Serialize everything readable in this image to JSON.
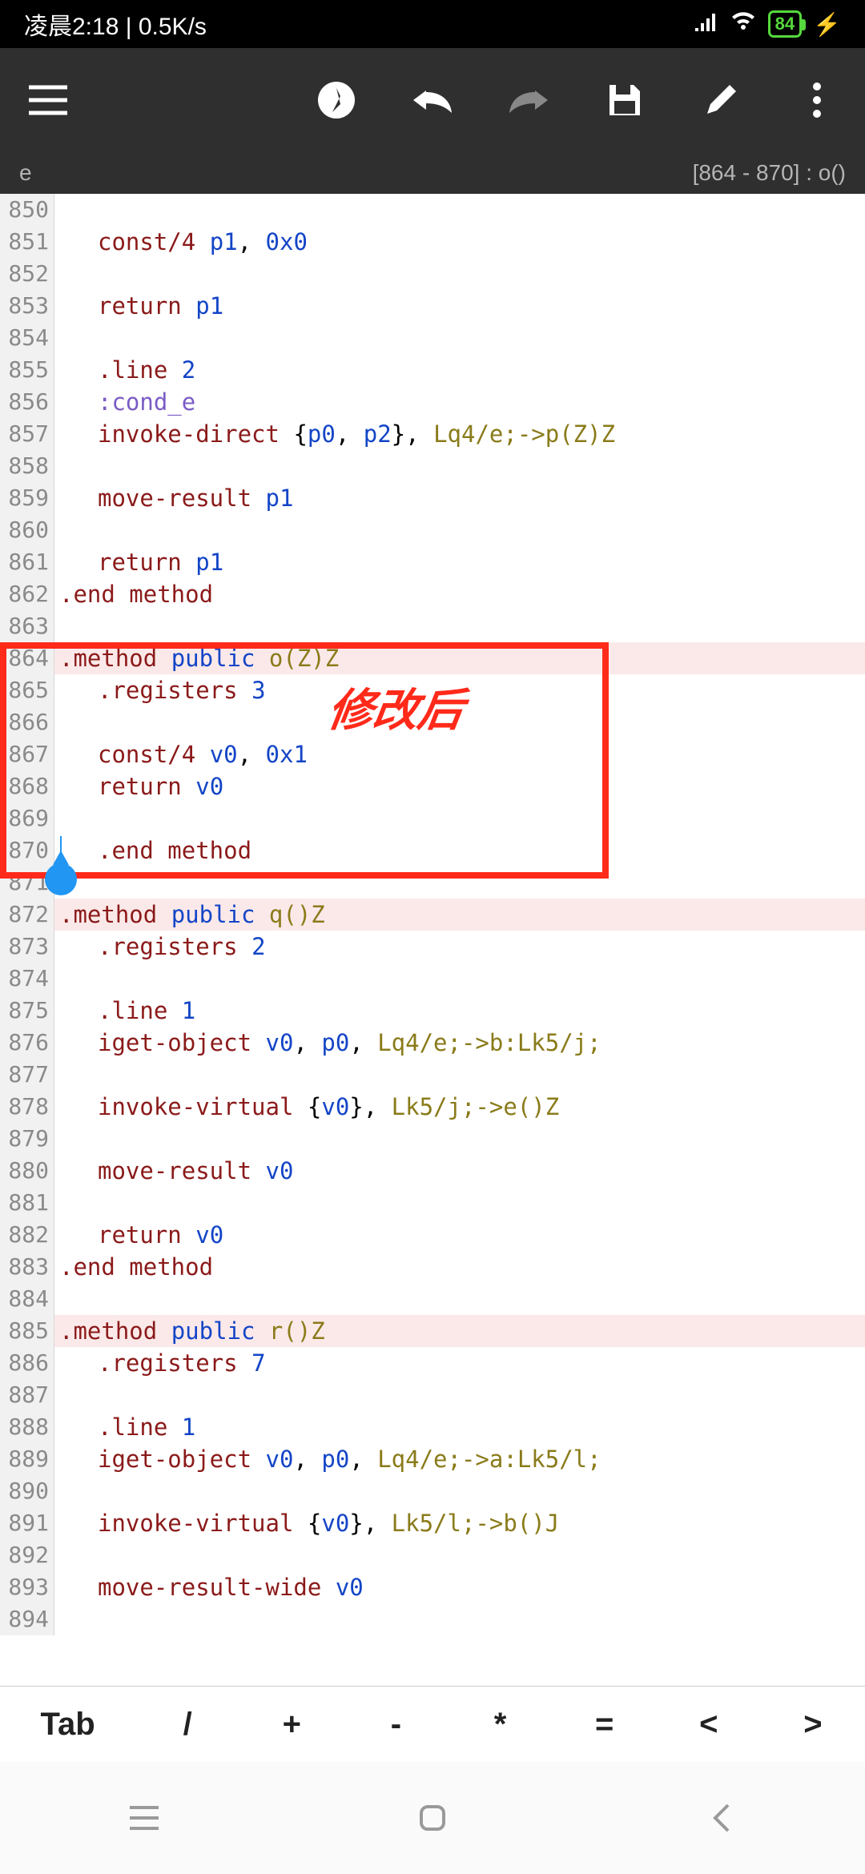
{
  "status": {
    "time_text": "凌晨2:18 | 0.5K/s",
    "battery": "84"
  },
  "meta": {
    "file": "e",
    "location": "[864 - 870] : o()"
  },
  "annotation": "修改后",
  "lines": [
    {
      "n": "850",
      "bg": "",
      "indent": 0,
      "tokens": []
    },
    {
      "n": "851",
      "bg": "",
      "indent": 1,
      "tokens": [
        {
          "c": "c-keyword",
          "t": "const/4"
        },
        {
          "c": "",
          "t": " "
        },
        {
          "c": "c-reg",
          "t": "p1"
        },
        {
          "c": "",
          "t": ", "
        },
        {
          "c": "c-num",
          "t": "0x0"
        }
      ]
    },
    {
      "n": "852",
      "bg": "",
      "indent": 0,
      "tokens": []
    },
    {
      "n": "853",
      "bg": "",
      "indent": 1,
      "tokens": [
        {
          "c": "c-keyword",
          "t": "return"
        },
        {
          "c": "",
          "t": " "
        },
        {
          "c": "c-reg",
          "t": "p1"
        }
      ]
    },
    {
      "n": "854",
      "bg": "",
      "indent": 0,
      "tokens": []
    },
    {
      "n": "855",
      "bg": "",
      "indent": 1,
      "tokens": [
        {
          "c": "c-keyword",
          "t": ".line"
        },
        {
          "c": "",
          "t": " "
        },
        {
          "c": "c-num",
          "t": "2"
        }
      ]
    },
    {
      "n": "856",
      "bg": "",
      "indent": 1,
      "tokens": [
        {
          "c": "c-label",
          "t": ":cond_e"
        }
      ]
    },
    {
      "n": "857",
      "bg": "",
      "indent": 1,
      "tokens": [
        {
          "c": "c-keyword",
          "t": "invoke-direct"
        },
        {
          "c": "",
          "t": " {"
        },
        {
          "c": "c-reg",
          "t": "p0"
        },
        {
          "c": "",
          "t": ", "
        },
        {
          "c": "c-reg",
          "t": "p2"
        },
        {
          "c": "",
          "t": "}, "
        },
        {
          "c": "c-type",
          "t": "Lq4/e;->p(Z)Z"
        }
      ]
    },
    {
      "n": "858",
      "bg": "",
      "indent": 0,
      "tokens": []
    },
    {
      "n": "859",
      "bg": "",
      "indent": 1,
      "tokens": [
        {
          "c": "c-keyword",
          "t": "move-result"
        },
        {
          "c": "",
          "t": " "
        },
        {
          "c": "c-reg",
          "t": "p1"
        }
      ]
    },
    {
      "n": "860",
      "bg": "",
      "indent": 0,
      "tokens": []
    },
    {
      "n": "861",
      "bg": "",
      "indent": 1,
      "tokens": [
        {
          "c": "c-keyword",
          "t": "return"
        },
        {
          "c": "",
          "t": " "
        },
        {
          "c": "c-reg",
          "t": "p1"
        }
      ]
    },
    {
      "n": "862",
      "bg": "",
      "indent": 0,
      "tokens": [
        {
          "c": "c-keyword",
          "t": ".end method"
        }
      ]
    },
    {
      "n": "863",
      "bg": "",
      "indent": 0,
      "tokens": []
    },
    {
      "n": "864",
      "bg": "bg-pink",
      "indent": 0,
      "tokens": [
        {
          "c": "c-keyword",
          "t": ".method"
        },
        {
          "c": "",
          "t": " "
        },
        {
          "c": "c-mod",
          "t": "public"
        },
        {
          "c": "",
          "t": " "
        },
        {
          "c": "c-type",
          "t": "o(Z)Z"
        }
      ]
    },
    {
      "n": "865",
      "bg": "",
      "indent": 1,
      "tokens": [
        {
          "c": "c-keyword",
          "t": ".registers"
        },
        {
          "c": "",
          "t": " "
        },
        {
          "c": "c-num",
          "t": "3"
        }
      ]
    },
    {
      "n": "866",
      "bg": "",
      "indent": 0,
      "tokens": []
    },
    {
      "n": "867",
      "bg": "",
      "indent": 1,
      "tokens": [
        {
          "c": "c-keyword",
          "t": "const/4"
        },
        {
          "c": "",
          "t": " "
        },
        {
          "c": "c-reg",
          "t": "v0"
        },
        {
          "c": "",
          "t": ", "
        },
        {
          "c": "c-num",
          "t": "0x1"
        }
      ]
    },
    {
      "n": "868",
      "bg": "",
      "indent": 1,
      "tokens": [
        {
          "c": "c-keyword",
          "t": "return"
        },
        {
          "c": "",
          "t": " "
        },
        {
          "c": "c-reg",
          "t": "v0"
        }
      ]
    },
    {
      "n": "869",
      "bg": "bg-yellow",
      "indent": 0,
      "tokens": []
    },
    {
      "n": "870",
      "bg": "",
      "indent": 1,
      "tokens": [
        {
          "c": "c-keyword",
          "t": ".end method"
        }
      ]
    },
    {
      "n": "871",
      "bg": "",
      "indent": 0,
      "tokens": []
    },
    {
      "n": "872",
      "bg": "bg-pink",
      "indent": 0,
      "tokens": [
        {
          "c": "c-keyword",
          "t": ".method"
        },
        {
          "c": "",
          "t": " "
        },
        {
          "c": "c-mod",
          "t": "public"
        },
        {
          "c": "",
          "t": " "
        },
        {
          "c": "c-type",
          "t": "q()Z"
        }
      ]
    },
    {
      "n": "873",
      "bg": "",
      "indent": 1,
      "tokens": [
        {
          "c": "c-keyword",
          "t": ".registers"
        },
        {
          "c": "",
          "t": " "
        },
        {
          "c": "c-num",
          "t": "2"
        }
      ]
    },
    {
      "n": "874",
      "bg": "",
      "indent": 0,
      "tokens": []
    },
    {
      "n": "875",
      "bg": "",
      "indent": 1,
      "tokens": [
        {
          "c": "c-keyword",
          "t": ".line"
        },
        {
          "c": "",
          "t": " "
        },
        {
          "c": "c-num",
          "t": "1"
        }
      ]
    },
    {
      "n": "876",
      "bg": "",
      "indent": 1,
      "tokens": [
        {
          "c": "c-keyword",
          "t": "iget-object"
        },
        {
          "c": "",
          "t": " "
        },
        {
          "c": "c-reg",
          "t": "v0"
        },
        {
          "c": "",
          "t": ", "
        },
        {
          "c": "c-reg",
          "t": "p0"
        },
        {
          "c": "",
          "t": ", "
        },
        {
          "c": "c-type",
          "t": "Lq4/e;->b:Lk5/j;"
        }
      ]
    },
    {
      "n": "877",
      "bg": "",
      "indent": 0,
      "tokens": []
    },
    {
      "n": "878",
      "bg": "",
      "indent": 1,
      "tokens": [
        {
          "c": "c-keyword",
          "t": "invoke-virtual"
        },
        {
          "c": "",
          "t": " {"
        },
        {
          "c": "c-reg",
          "t": "v0"
        },
        {
          "c": "",
          "t": "}, "
        },
        {
          "c": "c-type",
          "t": "Lk5/j;->e()Z"
        }
      ]
    },
    {
      "n": "879",
      "bg": "",
      "indent": 0,
      "tokens": []
    },
    {
      "n": "880",
      "bg": "",
      "indent": 1,
      "tokens": [
        {
          "c": "c-keyword",
          "t": "move-result"
        },
        {
          "c": "",
          "t": " "
        },
        {
          "c": "c-reg",
          "t": "v0"
        }
      ]
    },
    {
      "n": "881",
      "bg": "",
      "indent": 0,
      "tokens": []
    },
    {
      "n": "882",
      "bg": "",
      "indent": 1,
      "tokens": [
        {
          "c": "c-keyword",
          "t": "return"
        },
        {
          "c": "",
          "t": " "
        },
        {
          "c": "c-reg",
          "t": "v0"
        }
      ]
    },
    {
      "n": "883",
      "bg": "",
      "indent": 0,
      "tokens": [
        {
          "c": "c-keyword",
          "t": ".end method"
        }
      ]
    },
    {
      "n": "884",
      "bg": "",
      "indent": 0,
      "tokens": []
    },
    {
      "n": "885",
      "bg": "bg-pink",
      "indent": 0,
      "tokens": [
        {
          "c": "c-keyword",
          "t": ".method"
        },
        {
          "c": "",
          "t": " "
        },
        {
          "c": "c-mod",
          "t": "public"
        },
        {
          "c": "",
          "t": " "
        },
        {
          "c": "c-type",
          "t": "r()Z"
        }
      ]
    },
    {
      "n": "886",
      "bg": "",
      "indent": 1,
      "tokens": [
        {
          "c": "c-keyword",
          "t": ".registers"
        },
        {
          "c": "",
          "t": " "
        },
        {
          "c": "c-num",
          "t": "7"
        }
      ]
    },
    {
      "n": "887",
      "bg": "",
      "indent": 0,
      "tokens": []
    },
    {
      "n": "888",
      "bg": "",
      "indent": 1,
      "tokens": [
        {
          "c": "c-keyword",
          "t": ".line"
        },
        {
          "c": "",
          "t": " "
        },
        {
          "c": "c-num",
          "t": "1"
        }
      ]
    },
    {
      "n": "889",
      "bg": "",
      "indent": 1,
      "tokens": [
        {
          "c": "c-keyword",
          "t": "iget-object"
        },
        {
          "c": "",
          "t": " "
        },
        {
          "c": "c-reg",
          "t": "v0"
        },
        {
          "c": "",
          "t": ", "
        },
        {
          "c": "c-reg",
          "t": "p0"
        },
        {
          "c": "",
          "t": ", "
        },
        {
          "c": "c-type",
          "t": "Lq4/e;->a:Lk5/l;"
        }
      ]
    },
    {
      "n": "890",
      "bg": "",
      "indent": 0,
      "tokens": []
    },
    {
      "n": "891",
      "bg": "",
      "indent": 1,
      "tokens": [
        {
          "c": "c-keyword",
          "t": "invoke-virtual"
        },
        {
          "c": "",
          "t": " {"
        },
        {
          "c": "c-reg",
          "t": "v0"
        },
        {
          "c": "",
          "t": "}, "
        },
        {
          "c": "c-type",
          "t": "Lk5/l;->b()J"
        }
      ]
    },
    {
      "n": "892",
      "bg": "",
      "indent": 0,
      "tokens": []
    },
    {
      "n": "893",
      "bg": "",
      "indent": 1,
      "tokens": [
        {
          "c": "c-keyword",
          "t": "move-result-wide"
        },
        {
          "c": "",
          "t": " "
        },
        {
          "c": "c-reg",
          "t": "v0"
        }
      ]
    },
    {
      "n": "894",
      "bg": "",
      "indent": 0,
      "tokens": []
    }
  ],
  "keys": [
    "Tab",
    "/",
    "+",
    "-",
    "*",
    "=",
    "<",
    ">"
  ]
}
